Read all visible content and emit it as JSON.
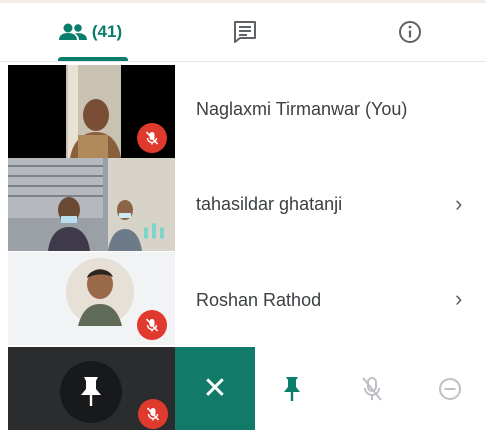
{
  "tabs": {
    "people_count": "(41)",
    "people_icon": "people-icon",
    "chat_icon": "chat-icon",
    "info_icon": "info-icon"
  },
  "participants": [
    {
      "name": "Naglaxmi Tirmanwar (You)",
      "mic": "muted"
    },
    {
      "name": "tahasildar ghatanji",
      "mic": "speaking"
    },
    {
      "name": "Roshan Rathod",
      "mic": "muted"
    }
  ],
  "actions": {
    "close_label": "✕",
    "pin_icon": "pin-icon",
    "mute_icon": "mic-off-icon",
    "remove_icon": "remove-icon"
  },
  "colors": {
    "accent": "#0b7d6c",
    "mute_red": "#e03a2f",
    "close_bg": "#117a69"
  }
}
